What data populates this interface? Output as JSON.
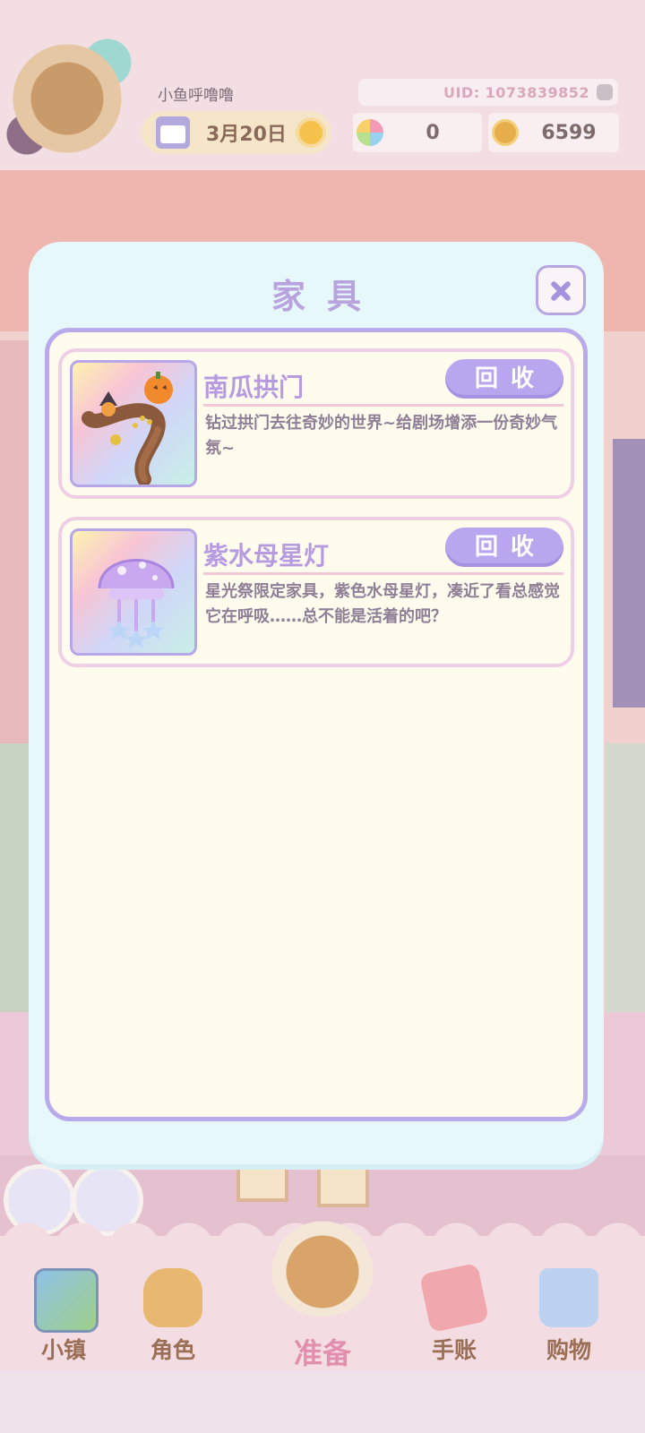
{
  "header": {
    "username": "小鱼呼噜噜",
    "uid": "UID: 1073839852",
    "date": "3月20日",
    "weather_icon": "sun-icon",
    "flower_count": "0",
    "coin_count": "6599"
  },
  "dialog": {
    "title": "家具",
    "items": [
      {
        "name": "南瓜拱门",
        "recycle_label": "回收",
        "description": "钻过拱门去往奇妙的世界~给剧场增添一份奇妙气氛~",
        "icon": "pumpkin-arch-icon"
      },
      {
        "name": "紫水母星灯",
        "recycle_label": "回收",
        "description": "星光祭限定家具，紫色水母星灯，凑近了看总感觉它在呼吸……总不能是活着的吧？",
        "icon": "jellyfish-lamp-icon"
      }
    ]
  },
  "nav": {
    "town": "小镇",
    "role": "角色",
    "prepare": "准备",
    "journal": "手账",
    "shop": "购物"
  },
  "colors": {
    "accent": "#b8a6ee",
    "title": "#b9a3df",
    "panel": "#fffcee",
    "dialog_bg": "#e7f8fb"
  }
}
